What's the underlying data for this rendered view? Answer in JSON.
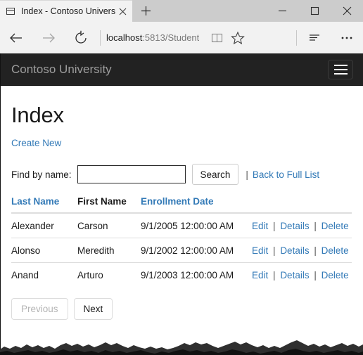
{
  "window": {
    "tab": {
      "title": "Index - Contoso Univers",
      "favicon": "page-outline-icon",
      "close": "✕"
    },
    "newtab_label": "+",
    "controls": {
      "minimize": "─",
      "maximize": "□",
      "close": "✕"
    }
  },
  "toolbar": {
    "back": "back-arrow-icon",
    "forward": "forward-arrow-icon",
    "refresh": "refresh-icon",
    "url_host": "localhost",
    "url_path": ":5813/Student",
    "reading_view": "book-icon",
    "favorite": "star-icon",
    "hub": "hub-icon",
    "more": "•••"
  },
  "site": {
    "brand": "Contoso University",
    "nav_toggle": "hamburger-icon"
  },
  "page": {
    "title": "Index",
    "create_new_label": "Create New",
    "search": {
      "label": "Find by name:",
      "value": "",
      "placeholder": "",
      "button_label": "Search",
      "divider": "|",
      "back_to_full_list_label": "Back to Full List"
    },
    "table": {
      "headers": [
        {
          "label": "Last Name",
          "sortable": true
        },
        {
          "label": "First Name",
          "sortable": false
        },
        {
          "label": "Enrollment Date",
          "sortable": true
        },
        {
          "label": "",
          "sortable": false
        }
      ],
      "rows": [
        {
          "last_name": "Alexander",
          "first_name": "Carson",
          "enrollment_date": "9/1/2005 12:00:00 AM",
          "actions": {
            "edit": "Edit",
            "details": "Details",
            "delete": "Delete"
          }
        },
        {
          "last_name": "Alonso",
          "first_name": "Meredith",
          "enrollment_date": "9/1/2002 12:00:00 AM",
          "actions": {
            "edit": "Edit",
            "details": "Details",
            "delete": "Delete"
          }
        },
        {
          "last_name": "Anand",
          "first_name": "Arturo",
          "enrollment_date": "9/1/2003 12:00:00 AM",
          "actions": {
            "edit": "Edit",
            "details": "Details",
            "delete": "Delete"
          }
        }
      ],
      "action_separator": "|"
    },
    "pager": {
      "previous_label": "Previous",
      "previous_disabled": true,
      "next_label": "Next",
      "next_disabled": false
    }
  },
  "colors": {
    "link": "#337ab7",
    "navbar": "#222222",
    "brand_text": "#9d9d9d",
    "titlebar": "#cccccc",
    "toolbar": "#f2f2f2",
    "table_border": "#dddddd"
  }
}
